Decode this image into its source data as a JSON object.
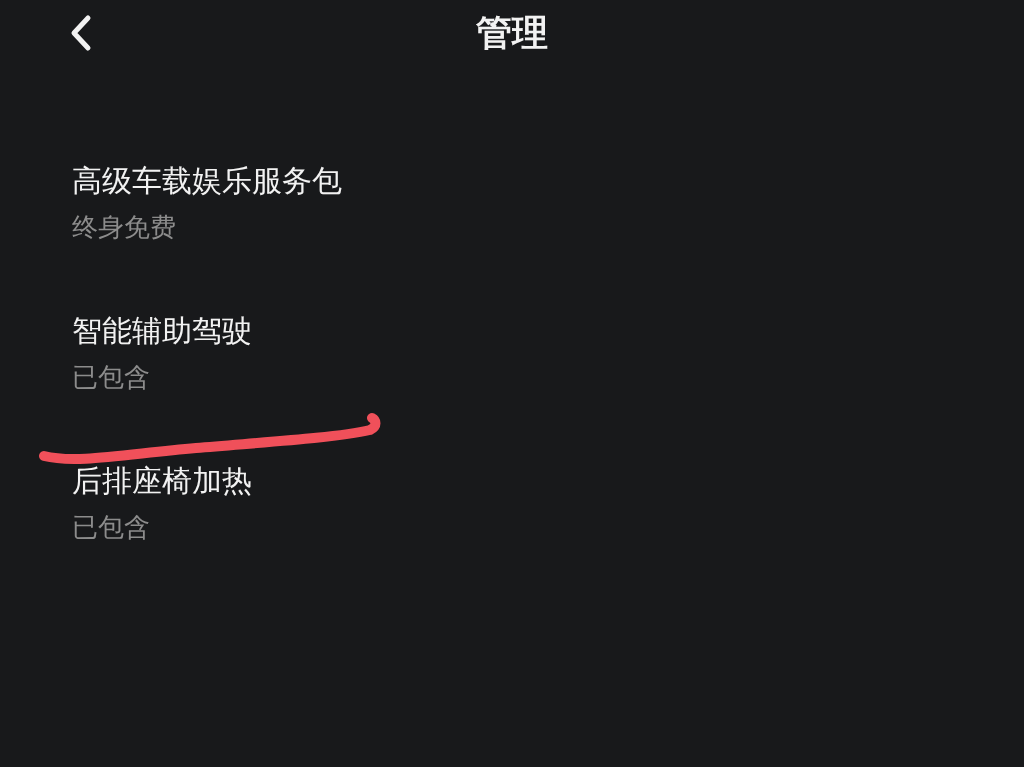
{
  "header": {
    "title": "管理"
  },
  "items": [
    {
      "title": "高级车载娱乐服务包",
      "subtitle": "终身免费"
    },
    {
      "title": "智能辅助驾驶",
      "subtitle": "已包含"
    },
    {
      "title": "后排座椅加热",
      "subtitle": "已包含"
    }
  ]
}
